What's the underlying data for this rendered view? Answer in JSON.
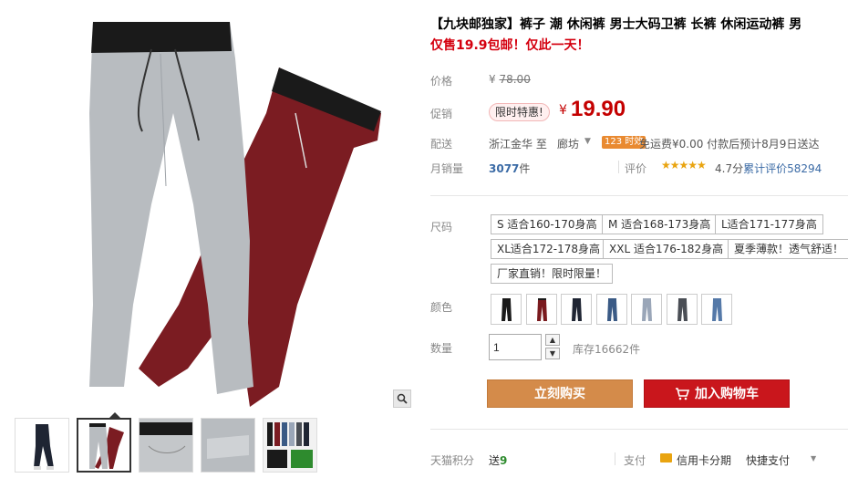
{
  "product": {
    "title": "【九块邮独家】裤子 潮 休闲裤 男士大码卫裤 长裤 休闲运动裤 男",
    "subtitle": "仅售19.9包邮！仅此一天！"
  },
  "price": {
    "label": "价格",
    "currency": "¥",
    "original": "78.00",
    "promo_label": "促销",
    "promo_tag": "限时特惠!",
    "promo_currency": "¥",
    "promo_price": "19.90"
  },
  "shipping": {
    "label": "配送",
    "from": "浙江金华",
    "to_word": "至",
    "destination": "廊坊",
    "badge": "123 时效",
    "info": "免运费¥0.00 付款后预计8月9日送达"
  },
  "sales": {
    "label": "月销量",
    "count": "3077",
    "unit": "件",
    "rating_label": "评价",
    "stars": "★★★★★",
    "rating": "4.7分",
    "total_reviews_label": "累计评价",
    "total_reviews": "58294"
  },
  "size": {
    "label": "尺码",
    "options": [
      "S 适合160-170身高",
      "M 适合168-173身高",
      "L适合171-177身高",
      "XL适合172-178身高",
      "XXL 适合176-182身高",
      "夏季薄款！透气舒适！",
      "厂家直销！限时限量！"
    ]
  },
  "color": {
    "label": "颜色",
    "swatches": [
      {
        "name": "black-pants",
        "color": "#1a1a1a",
        "waist": "#1a1a1a"
      },
      {
        "name": "red-pants",
        "color": "#7a1a1e",
        "waist": "#1a1a1a"
      },
      {
        "name": "navy-pants",
        "color": "#1f2533",
        "waist": "#1f2533"
      },
      {
        "name": "blue-jeans",
        "color": "#3a5a85",
        "waist": "#3a5a85"
      },
      {
        "name": "light-jeans",
        "color": "#9aa6b8",
        "waist": "#9aa6b8"
      },
      {
        "name": "grey-jeans",
        "color": "#4a4e55",
        "waist": "#4a4e55"
      },
      {
        "name": "denim-jeans",
        "color": "#5579a8",
        "waist": "#5579a8"
      }
    ]
  },
  "quantity": {
    "label": "数量",
    "value": "1",
    "stock": "库存16662件"
  },
  "actions": {
    "buy_now": "立刻购买",
    "add_to_cart": "加入购物车"
  },
  "footer": {
    "points_label": "天猫积分",
    "points_prefix": "送",
    "points_value": "9",
    "pay_label": "支付",
    "credit_card": "信用卡分期",
    "quick_pay": "快捷支付"
  },
  "gallery": {
    "thumbnails": [
      {
        "name": "thumb-model",
        "active": false
      },
      {
        "name": "thumb-grey-red",
        "active": true
      },
      {
        "name": "thumb-detail-1",
        "active": false
      },
      {
        "name": "thumb-detail-2",
        "active": false
      },
      {
        "name": "thumb-collage",
        "active": false
      }
    ],
    "main_colors": {
      "grey": "#b8bcc0",
      "red": "#7b1c22",
      "waist": "#1a1a1a"
    }
  }
}
